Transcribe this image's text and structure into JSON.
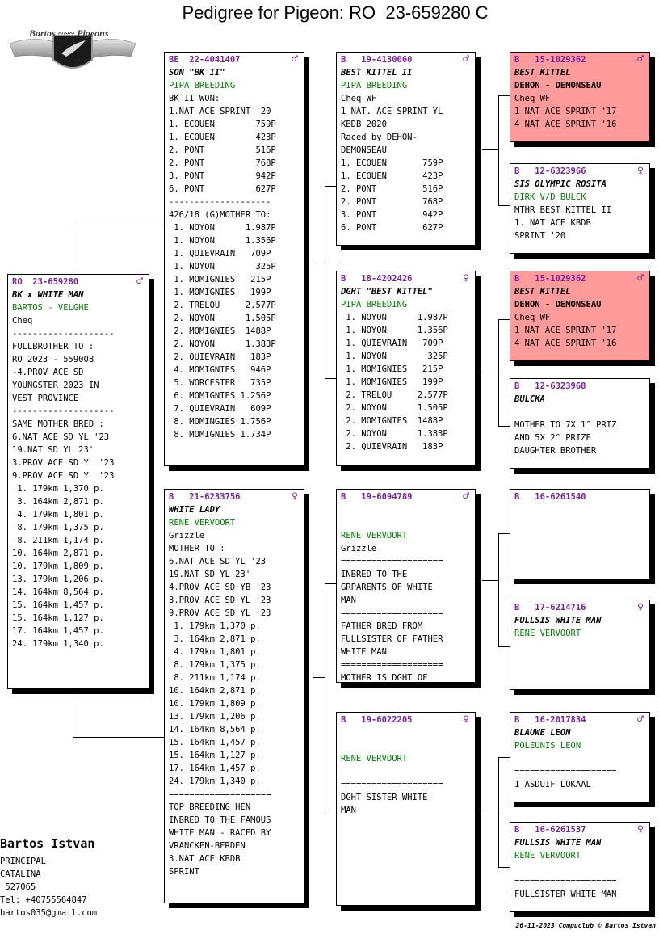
{
  "title": "Pedigree for Pigeon: RO  23-659280 C",
  "logo": {
    "text": "Bartos ~~~ Pigeons"
  },
  "cards": {
    "subject": {
      "ring": "RO  23-659280",
      "sex": "♂",
      "lines": [
        {
          "t": "BK x WHITE MAN",
          "c": "name"
        },
        {
          "t": "BARTOS - VELGHE",
          "c": "owner"
        },
        {
          "t": "Cheq"
        },
        {
          "t": "--------------------"
        },
        {
          "t": "FULLBROTHER TO :"
        },
        {
          "t": "RO 2023 - 559008"
        },
        {
          "t": "-4.PROV ACE SD"
        },
        {
          "t": "YOUNGSTER 2023 IN"
        },
        {
          "t": "VEST PROVINCE"
        },
        {
          "t": "--------------------"
        },
        {
          "t": "SAME MOTHER BRED :"
        },
        {
          "t": "6.NAT ACE SD YL '23"
        },
        {
          "t": "19.NAT SD YL 23'"
        },
        {
          "t": "3.PROV ACE SD YL '23"
        },
        {
          "t": "9.PROV ACE SD YL '23"
        },
        {
          "t": " 1. 179km 1,370 p."
        },
        {
          "t": " 3. 164km 2,871 p."
        },
        {
          "t": " 4. 179km 1,801 p."
        },
        {
          "t": " 8. 179km 1,375 p."
        },
        {
          "t": " 8. 211km 1,174 p."
        },
        {
          "t": "10. 164km 2,871 p."
        },
        {
          "t": "10. 179km 1,809 p."
        },
        {
          "t": "13. 179km 1,206 p."
        },
        {
          "t": "14. 164km 8,564 p."
        },
        {
          "t": "15. 164km 1,457 p."
        },
        {
          "t": "15. 164km 1,127 p."
        },
        {
          "t": "17. 164km 1,457 p."
        },
        {
          "t": "24. 179km 1,340 p."
        }
      ]
    },
    "father": {
      "ring": "BE  22-4041407",
      "sex": "♂",
      "lines": [
        {
          "t": "SON \"BK II\"",
          "c": "name"
        },
        {
          "t": "PIPA BREEDING",
          "c": "owner"
        },
        {
          "t": "BK II WON:"
        },
        {
          "t": "1.NAT ACE SPRINT '20"
        },
        {
          "t": "1. ECOUEN        759P"
        },
        {
          "t": "1. ECOUEN        423P"
        },
        {
          "t": "2. PONT          516P"
        },
        {
          "t": "2. PONT          768P"
        },
        {
          "t": "3. PONT          942P"
        },
        {
          "t": "6. PONT          627P"
        },
        {
          "t": "--------------------"
        },
        {
          "t": "426/18 (G)MOTHER TO:"
        },
        {
          "t": " 1. NOYON      1.987P"
        },
        {
          "t": " 1. NOYON      1.356P"
        },
        {
          "t": " 1. QUIEVRAIN   709P"
        },
        {
          "t": " 1. NOYON        325P"
        },
        {
          "t": " 1. MOMIGNIES   215P"
        },
        {
          "t": " 1. MOMIGNIES   199P"
        },
        {
          "t": " 2. TRELOU     2.577P"
        },
        {
          "t": " 2. NOYON      1.505P"
        },
        {
          "t": " 2. MOMIGNIES  1488P"
        },
        {
          "t": " 2. NOYON      1.383P"
        },
        {
          "t": " 2. QUIEVRAIN   183P"
        },
        {
          "t": " 4. MOMIGNIES   946P"
        },
        {
          "t": " 5. WORCESTER   735P"
        },
        {
          "t": " 6. MOMIGNIES 1.256P"
        },
        {
          "t": " 7. QUIEVRAIN   609P"
        },
        {
          "t": " 8. MOMINGIES 1.756P"
        },
        {
          "t": " 8. MOMIGNIES 1.734P"
        }
      ]
    },
    "mother": {
      "ring": "B   21-6233756",
      "sex": "♀",
      "lines": [
        {
          "t": "WHITE LADY",
          "c": "name"
        },
        {
          "t": "RENE VERVOORT",
          "c": "owner"
        },
        {
          "t": "Grizzle"
        },
        {
          "t": "MOTHER TO :"
        },
        {
          "t": "6.NAT ACE SD YL '23"
        },
        {
          "t": "19.NAT SD YL 23'"
        },
        {
          "t": "4.PROV ACE SD YB '23"
        },
        {
          "t": "3.PROV ACE SD YL '23"
        },
        {
          "t": "9.PROV ACE SD YL '23"
        },
        {
          "t": " 1. 179km 1,370 p."
        },
        {
          "t": " 3. 164km 2,871 p."
        },
        {
          "t": " 4. 179km 1,801 p."
        },
        {
          "t": " 8. 179km 1,375 p."
        },
        {
          "t": " 8. 211km 1,174 p."
        },
        {
          "t": "10. 164km 2,871 p."
        },
        {
          "t": "10. 179km 1,809 p."
        },
        {
          "t": "13. 179km 1,206 p."
        },
        {
          "t": "14. 164km 8,564 p."
        },
        {
          "t": "15. 164km 1,457 p."
        },
        {
          "t": "15. 164km 1,127 p."
        },
        {
          "t": "17. 164km 1,457 p."
        },
        {
          "t": "24. 179km 1,340 p."
        },
        {
          "t": "===================="
        },
        {
          "t": "TOP BREEDING HEN"
        },
        {
          "t": "INBRED TO THE FAMOUS"
        },
        {
          "t": "WHITE MAN - RACED BY"
        },
        {
          "t": "VRANCKEN-BERDEN"
        },
        {
          "t": "3.NAT ACE KBDB"
        },
        {
          "t": "SPRINT"
        }
      ]
    },
    "ff": {
      "ring": "B   19-4130060",
      "sex": "♂",
      "lines": [
        {
          "t": "BEST KITTEL II",
          "c": "name"
        },
        {
          "t": "PIPA BREEDING",
          "c": "owner"
        },
        {
          "t": "Cheq WF"
        },
        {
          "t": "1 NAT. ACE SPRINT YL"
        },
        {
          "t": "KBDB 2020"
        },
        {
          "t": "Raced by DEHON-"
        },
        {
          "t": "DEMONSEAU"
        },
        {
          "t": "1. ECOUEN       759P"
        },
        {
          "t": "1. ECOUEN       423P"
        },
        {
          "t": "2. PONT         516P"
        },
        {
          "t": "2. PONT         768P"
        },
        {
          "t": "3. PONT         942P"
        },
        {
          "t": "6. PONT         627P"
        }
      ]
    },
    "fm": {
      "ring": "B   18-4202426",
      "sex": "♀",
      "lines": [
        {
          "t": "DGHT \"BEST KITTEL\"",
          "c": "name"
        },
        {
          "t": "PIPA BREEDING",
          "c": "owner"
        },
        {
          "t": " 1. NOYON      1.987P"
        },
        {
          "t": " 1. NOYON      1.356P"
        },
        {
          "t": " 1. QUIEVRAIN   709P"
        },
        {
          "t": " 1. NOYON        325P"
        },
        {
          "t": " 1. MOMIGNIES   215P"
        },
        {
          "t": " 1. MOMIGNIES   199P"
        },
        {
          "t": " 2. TRELOU     2.577P"
        },
        {
          "t": " 2. NOYON      1.505P"
        },
        {
          "t": " 2. MOMIGNIES  1488P"
        },
        {
          "t": " 2. NOYON      1.383P"
        },
        {
          "t": " 2. QUIEVRAIN   183P"
        }
      ]
    },
    "mf": {
      "ring": "B   19-6094789",
      "sex": "♂",
      "lines": [
        {
          "t": ""
        },
        {
          "t": ""
        },
        {
          "t": "RENE VERVOORT",
          "c": "owner"
        },
        {
          "t": "Grizzle"
        },
        {
          "t": "===================="
        },
        {
          "t": "INBRED TO THE"
        },
        {
          "t": "GRPARENTS OF WHITE"
        },
        {
          "t": "MAN"
        },
        {
          "t": "===================="
        },
        {
          "t": "FATHER BRED FROM"
        },
        {
          "t": "FULLSISTER OF FATHER"
        },
        {
          "t": "WHITE MAN"
        },
        {
          "t": "===================="
        },
        {
          "t": "MOTHER IS DGHT OF"
        }
      ]
    },
    "mm": {
      "ring": "B   19-6022205",
      "sex": "♀",
      "lines": [
        {
          "t": ""
        },
        {
          "t": ""
        },
        {
          "t": "RENE VERVOORT",
          "c": "owner"
        },
        {
          "t": ""
        },
        {
          "t": "===================="
        },
        {
          "t": "DGHT SISTER WHITE"
        },
        {
          "t": "MAN"
        }
      ]
    },
    "fff": {
      "ring": "B   15-1029362",
      "sex": "♂",
      "red": true,
      "lines": [
        {
          "t": "BEST KITTEL",
          "c": "name"
        },
        {
          "t": "DEHON - DEMONSEAU",
          "c": "owner"
        },
        {
          "t": "Cheq WF"
        },
        {
          "t": "1 NAT ACE SPRINT '17"
        },
        {
          "t": "4 NAT ACE SPRINT '16"
        }
      ]
    },
    "ffm": {
      "ring": "B   12-6323966",
      "sex": "♀",
      "lines": [
        {
          "t": "SIS OLYMPIC ROSITA",
          "c": "name"
        },
        {
          "t": "DIRK V/D BULCK",
          "c": "owner"
        },
        {
          "t": "MTHR BEST KITTEL II"
        },
        {
          "t": "1. NAT ACE KBDB"
        },
        {
          "t": "SPRINT '20"
        }
      ]
    },
    "fmf": {
      "ring": "B   15-1029362",
      "sex": "♂",
      "red": true,
      "lines": [
        {
          "t": "BEST KITTEL",
          "c": "name"
        },
        {
          "t": "DEHON - DEMONSEAU",
          "c": "owner"
        },
        {
          "t": "Cheq WF"
        },
        {
          "t": "1 NAT ACE SPRINT '17"
        },
        {
          "t": "4 NAT ACE SPRINT '16"
        }
      ]
    },
    "fmm": {
      "ring": "B   12-6323968",
      "sex": "",
      "lines": [
        {
          "t": "BULCKA",
          "c": "name"
        },
        {
          "t": ""
        },
        {
          "t": "MOTHER TO 7X 1° PRIZ"
        },
        {
          "t": "AND 5X 2° PRIZE"
        },
        {
          "t": "DAUGHTER BROTHER"
        }
      ]
    },
    "mff": {
      "ring": "B   16-6261540",
      "sex": "",
      "lines": []
    },
    "mfm": {
      "ring": "B   17-6214716",
      "sex": "♀",
      "lines": [
        {
          "t": "FULLSIS WHITE MAN",
          "c": "name"
        },
        {
          "t": "RENE VERVOORT",
          "c": "owner"
        }
      ]
    },
    "mmf": {
      "ring": "B   16-2017834",
      "sex": "♂",
      "lines": [
        {
          "t": "BLAUWE LEON",
          "c": "name"
        },
        {
          "t": "POLEUNIS LEON",
          "c": "owner"
        },
        {
          "t": ""
        },
        {
          "t": "===================="
        },
        {
          "t": "1 ASDUIF LOKAAL"
        }
      ]
    },
    "mmm": {
      "ring": "B   16-6261537",
      "sex": "♀",
      "lines": [
        {
          "t": "FULLSIS WHITE MAN",
          "c": "name"
        },
        {
          "t": "RENE VERVOORT",
          "c": "owner"
        },
        {
          "t": ""
        },
        {
          "t": "===================="
        },
        {
          "t": "FULLSISTER WHITE MAN"
        }
      ]
    }
  },
  "breeder": {
    "name": "Bartos Istvan",
    "lines": [
      "PRINCIPAL",
      "CATALINA",
      " 527065",
      "Tel: +40755564847",
      "bartos035@gmail.com"
    ]
  },
  "footer": "26-11-2023   Compuclub © Bartos Istvan"
}
